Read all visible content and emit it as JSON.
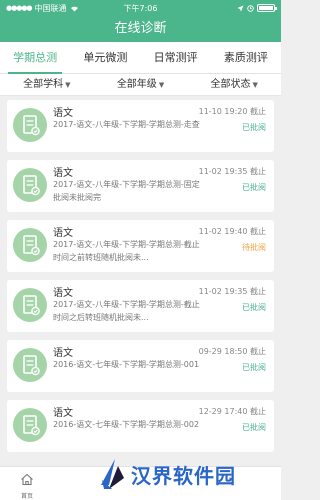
{
  "status_bar": {
    "carrier": "中国联通",
    "time": "下午7:06"
  },
  "header": {
    "title": "在线诊断"
  },
  "tabs": [
    {
      "label": "学期总测",
      "active": true
    },
    {
      "label": "单元微测",
      "active": false
    },
    {
      "label": "日常测评",
      "active": false
    },
    {
      "label": "素质测评",
      "active": false
    }
  ],
  "filters": [
    {
      "label": "全部学科"
    },
    {
      "label": "全部年级"
    },
    {
      "label": "全部状态"
    }
  ],
  "items": [
    {
      "subject": "语文",
      "title": "2017-语文-八年级-下学期-学期总测-走查",
      "deadline": "11-10 19:20 截止",
      "status": "已批阅",
      "status_type": "done"
    },
    {
      "subject": "语文",
      "title": "2017-语文-八年级-下学期-学期总测-固定批阅未批阅完",
      "deadline": "11-02 19:35 截止",
      "status": "已批阅",
      "status_type": "done"
    },
    {
      "subject": "语文",
      "title": "2017-语文-八年级-下学期-学期总测-截止时间之前转班随机批阅未...",
      "deadline": "11-02 19:40 截止",
      "status": "待批阅",
      "status_type": "pending"
    },
    {
      "subject": "语文",
      "title": "2017-语文-八年级-下学期-学期总测-截止时间之后转班随机批阅未...",
      "deadline": "11-02 19:35 截止",
      "status": "已批阅",
      "status_type": "done"
    },
    {
      "subject": "语文",
      "title": "2016-语文-七年级-下学期-学期总测-001",
      "deadline": "09-29 18:50 截止",
      "status": "已批阅",
      "status_type": "done"
    },
    {
      "subject": "语文",
      "title": "2016-语文-七年级-下学期-学期总测-002",
      "deadline": "12-29 17:40 截止",
      "status": "已批阅",
      "status_type": "done"
    }
  ],
  "bottom_bar": {
    "home_label": "首页"
  },
  "watermark": {
    "text": "汉界软件园"
  },
  "colors": {
    "accent": "#4bb58c",
    "pending": "#f0a23c",
    "icon_bg": "#a4d4a8",
    "watermark": "#2a66c8"
  }
}
